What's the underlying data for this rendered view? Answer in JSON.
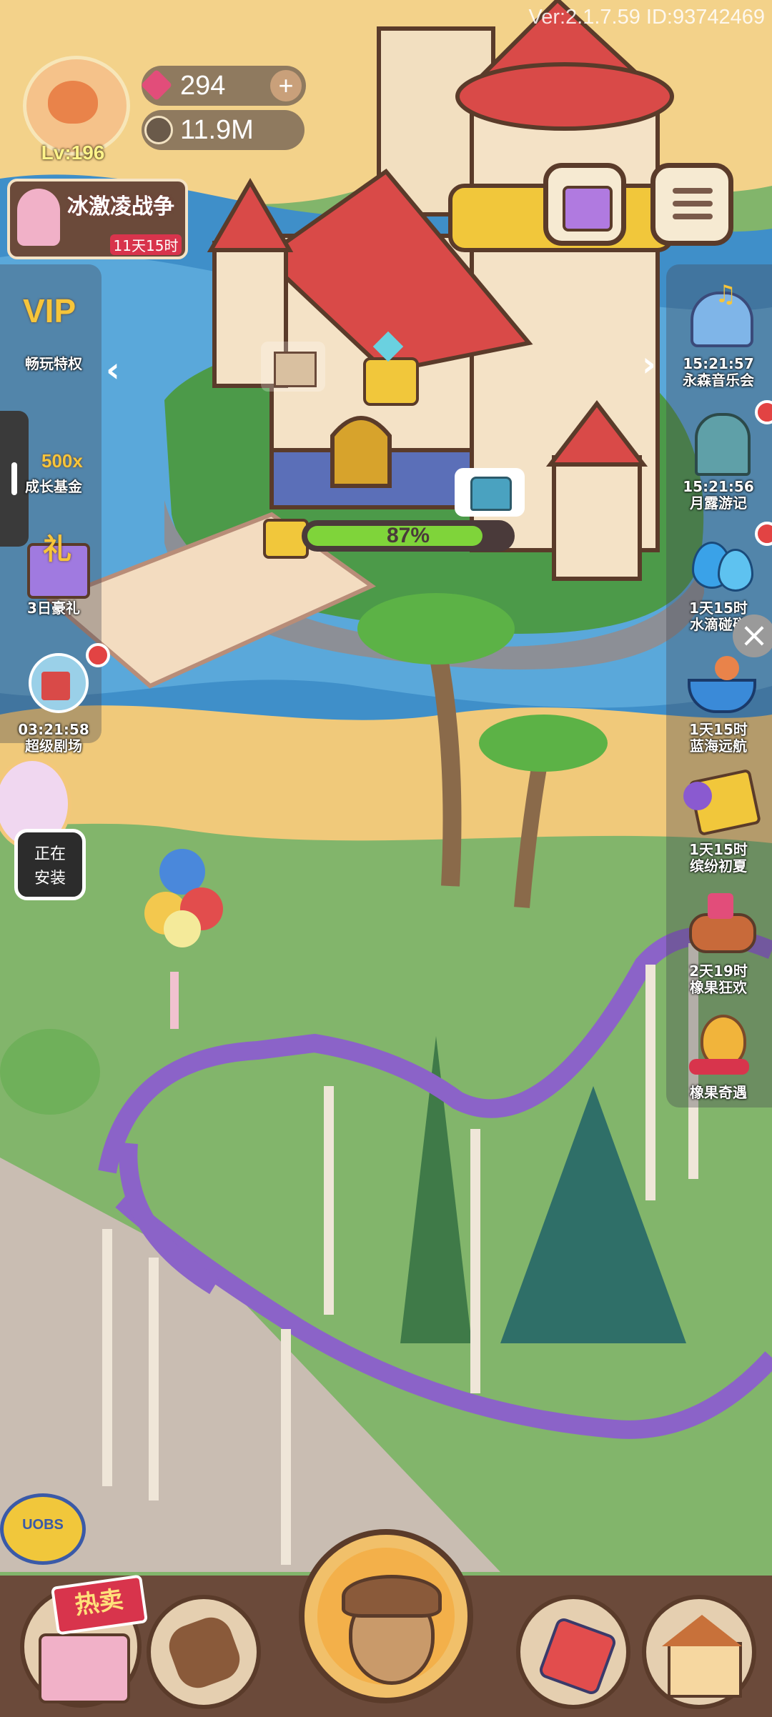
{
  "hud": {
    "version": "Ver:2.1.7.59 ID:93742469",
    "level": "Lv:196",
    "gems": "294",
    "acorns": "11.9M",
    "promo_title": "冰激凌战争",
    "promo_timer": "11天15时",
    "installing": "正在安装"
  },
  "left_events": [
    {
      "label": "畅玩特权",
      "timer": ""
    },
    {
      "label": "成长基金",
      "timer": ""
    },
    {
      "label": "3日豪礼",
      "timer": ""
    },
    {
      "label": "超级剧场",
      "timer": "03:21:58"
    }
  ],
  "right_events": [
    {
      "label": "永森音乐会",
      "timer": "15:21:57"
    },
    {
      "label": "月露游记",
      "timer": "15:21:56"
    },
    {
      "label": "水滴碰碰",
      "timer": "1天15时"
    },
    {
      "label": "蓝海远航",
      "timer": "1天15时"
    },
    {
      "label": "缤纷初夏",
      "timer": "1天15时"
    },
    {
      "label": "橡果狂欢",
      "timer": "2天19时"
    },
    {
      "label": "橡果奇遇",
      "timer": ""
    }
  ],
  "left_badges": {
    "vip": "VIP",
    "fund": "500x",
    "gift": "礼"
  },
  "castle": {
    "progress_text": "87%",
    "progress": 0.87
  },
  "bottom": {
    "hot_sale": "热卖",
    "sign": "UOBS"
  },
  "colors": {
    "progress": "#7fd43a",
    "gem": "#e24d7a",
    "roof": "#d94a48",
    "track": "#8b63c8"
  }
}
